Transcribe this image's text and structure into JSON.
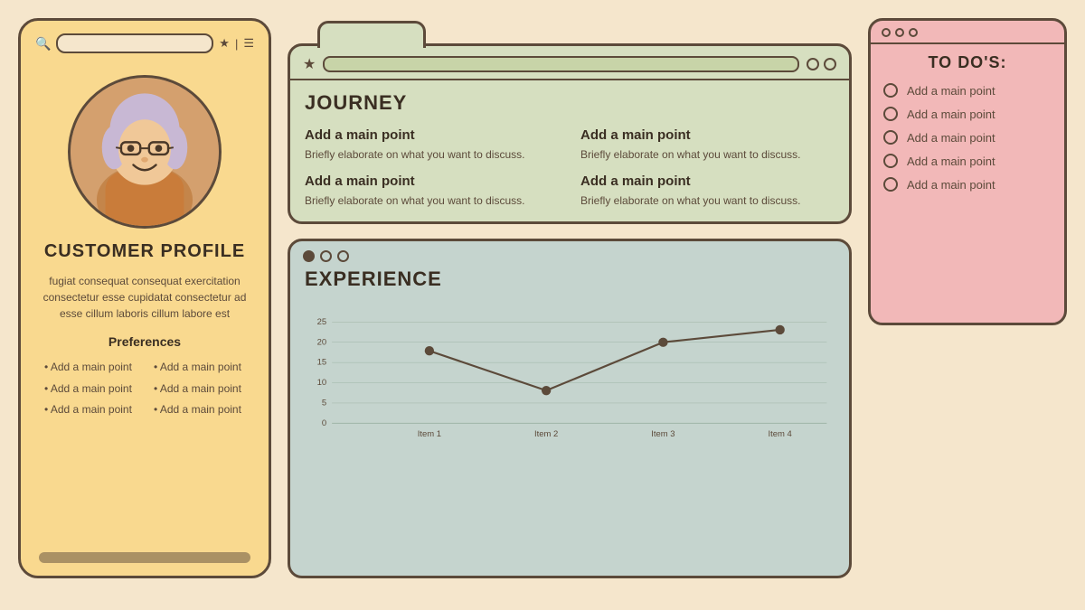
{
  "profile": {
    "title": "CUSTOMER PROFILE",
    "description": "fugiat consequat consequat exercitation consectetur esse cupidatat consectetur ad esse cillum laboris cillum labore est",
    "preferences_title": "Preferences",
    "preferences": [
      "Add a main point",
      "Add a main point",
      "Add a main point",
      "Add a main point",
      "Add a main point",
      "Add a main point"
    ]
  },
  "journey": {
    "title": "JOURNEY",
    "items": [
      {
        "title": "Add a main point",
        "desc": "Briefly elaborate on what you want to discuss."
      },
      {
        "title": "Add a main point",
        "desc": "Briefly elaborate on what you want to discuss."
      },
      {
        "title": "Add a main point",
        "desc": "Briefly elaborate on what you want to discuss."
      },
      {
        "title": "Add a main point",
        "desc": "Briefly elaborate on what you want to discuss."
      }
    ]
  },
  "experience": {
    "title": "EXPERIENCE",
    "chart": {
      "labels": [
        "Item 1",
        "Item 2",
        "Item 3",
        "Item 4"
      ],
      "values": [
        18,
        8,
        20,
        23
      ],
      "y_ticks": [
        0,
        5,
        10,
        15,
        20,
        25
      ]
    }
  },
  "todo": {
    "title": "TO DO'S:",
    "items": [
      "Add a main point",
      "Add a main point",
      "Add a main point",
      "Add a main point",
      "Add a main point"
    ]
  }
}
